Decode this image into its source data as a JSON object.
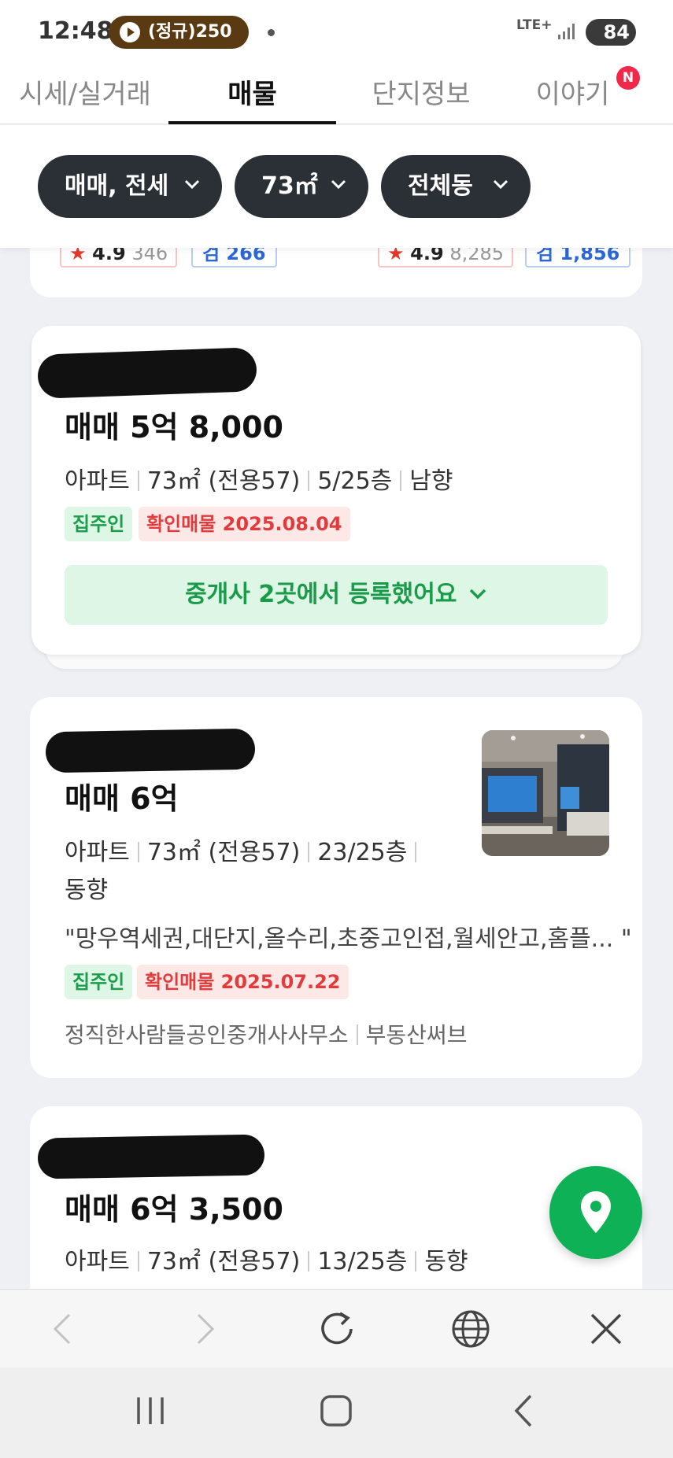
{
  "status_bar": {
    "time": "12:48",
    "media_label": "(정규)250",
    "network": "LTE+",
    "battery": "84"
  },
  "tabs": [
    {
      "label": "시세/실거래",
      "active": false
    },
    {
      "label": "매물",
      "active": true
    },
    {
      "label": "단지정보",
      "active": false
    },
    {
      "label": "이야기",
      "active": false,
      "badge": "N"
    }
  ],
  "filters": [
    {
      "label": "매매, 전세"
    },
    {
      "label": "73㎡"
    },
    {
      "label": "전체동"
    }
  ],
  "partial_card": {
    "left": {
      "star": "★",
      "score": "4.9",
      "count": "346",
      "review": "검 266"
    },
    "right": {
      "star": "★",
      "score": "4.9",
      "count": "8,285",
      "review": "검 1,856"
    }
  },
  "listings": [
    {
      "price": "매매 5억 8,000",
      "type": "아파트",
      "area": "73㎡ (전용57)",
      "floor": "5/25층",
      "direction": "남향",
      "tag_owner": "집주인",
      "tag_confirm": "확인매물 2025.08.04",
      "agent_note": "중개사 2곳에서 등록했어요"
    },
    {
      "price": "매매 6억",
      "type": "아파트",
      "area": "73㎡ (전용57)",
      "floor": "23/25층",
      "direction": "동향",
      "description": "\"망우역세권,대단지,올수리,초중고인접,월세안고,홈플... \"",
      "tag_owner": "집주인",
      "tag_confirm": "확인매물 2025.07.22",
      "broker": "정직한사람들공인중개사사무소",
      "source": "부동산써브"
    },
    {
      "price": "매매 6억 3,500",
      "type": "아파트",
      "area": "73㎡ (전용57)",
      "floor": "13/25층",
      "direction": "동향"
    }
  ],
  "colors": {
    "accent_green": "#0fb157",
    "chip_dark": "#2b2f36",
    "confirm_red": "#e13b3b",
    "badge_red": "#f0294b"
  },
  "icons": [
    "play-icon",
    "chevron-down-icon",
    "location-pin-icon",
    "back-arrow-icon",
    "forward-arrow-icon",
    "refresh-icon",
    "globe-icon",
    "close-icon",
    "recent-apps-icon",
    "home-icon",
    "system-back-icon"
  ]
}
